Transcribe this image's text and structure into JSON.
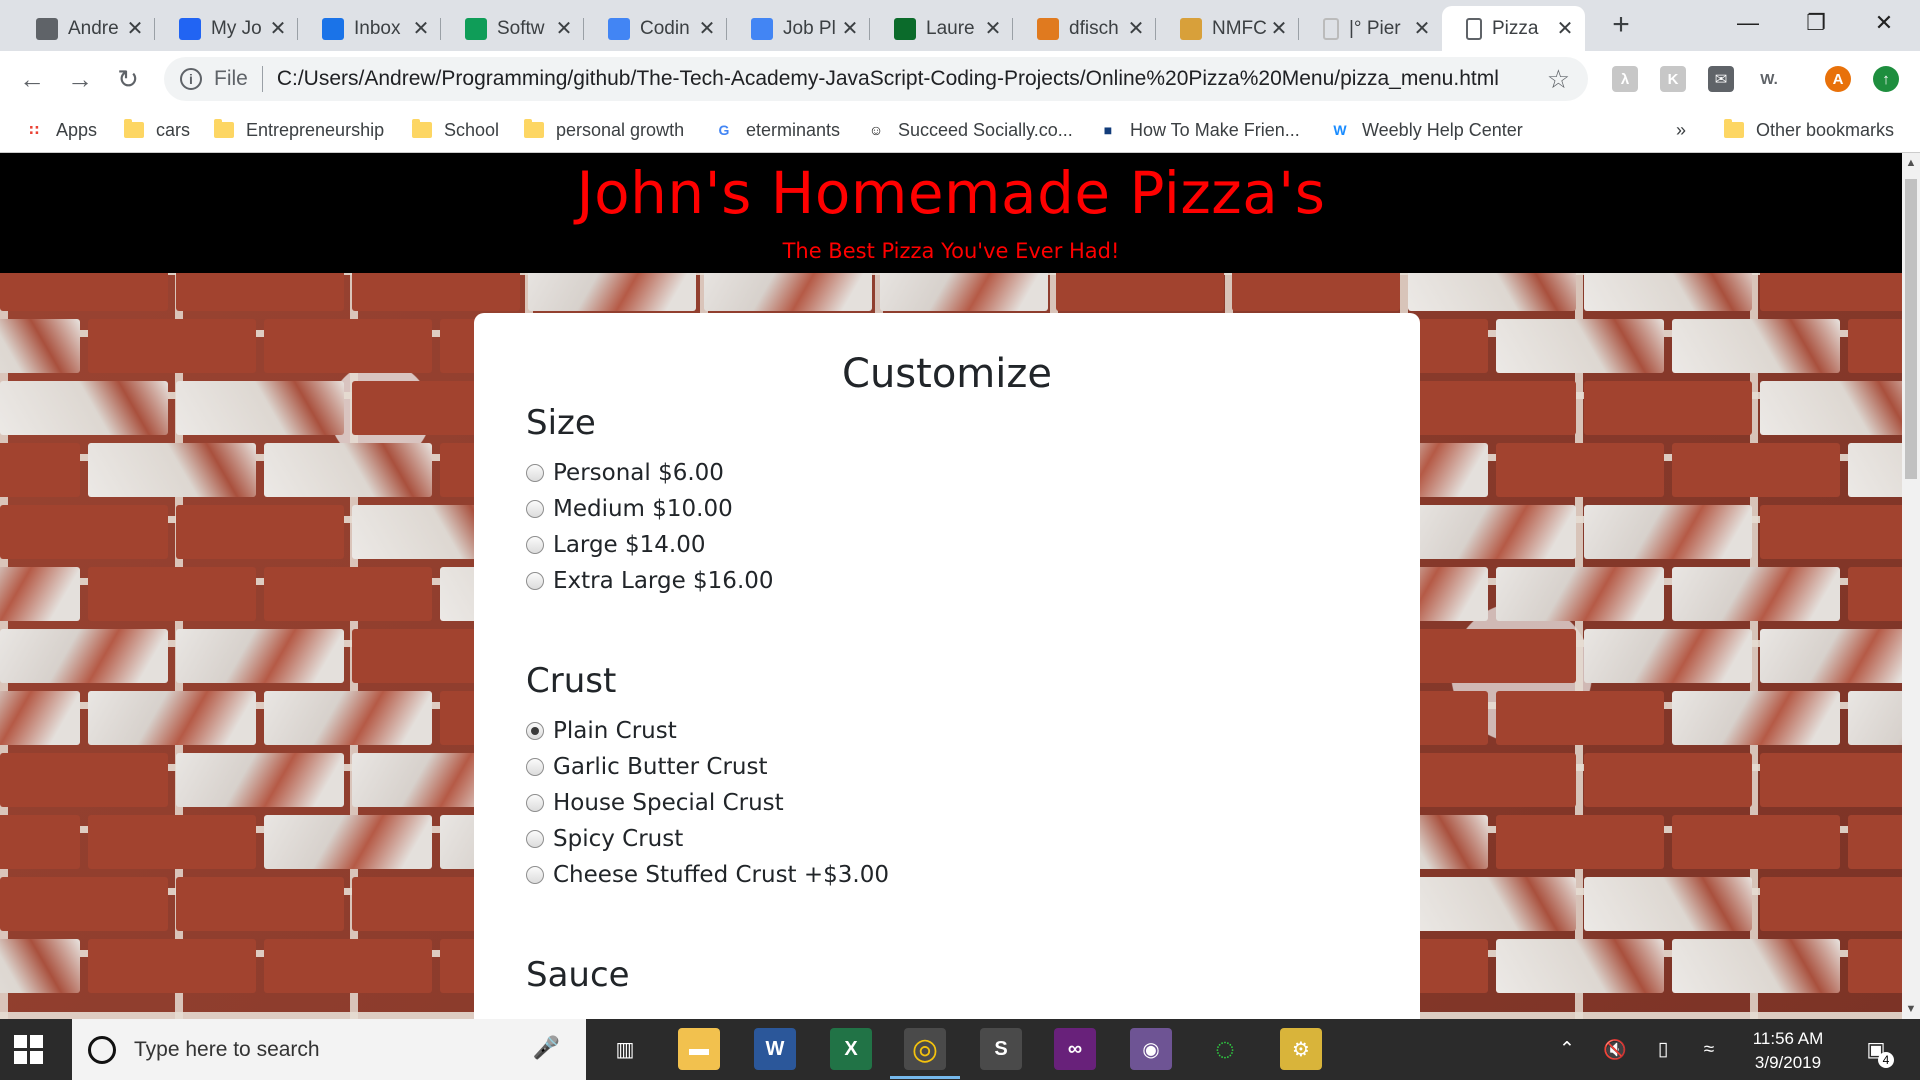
{
  "browser": {
    "tabs": [
      {
        "title": "Andre",
        "icon": "newspaper-icon",
        "color": "#5f6368"
      },
      {
        "title": "My Jo",
        "icon": "indeed-icon",
        "color": "#2164f3"
      },
      {
        "title": "Inbox",
        "icon": "mail-icon",
        "color": "#1a73e8"
      },
      {
        "title": "Softw",
        "icon": "google-drive-icon",
        "color": "#0f9d58"
      },
      {
        "title": "Codin",
        "icon": "google-docs-icon",
        "color": "#4285f4"
      },
      {
        "title": "Job Pl",
        "icon": "google-docs-icon",
        "color": "#4285f4"
      },
      {
        "title": "Laure",
        "icon": "spreadsheet-icon",
        "color": "#0b6b2b"
      },
      {
        "title": "dfisch",
        "icon": "github-cat-icon",
        "color": "#e07a1f"
      },
      {
        "title": "NMFC",
        "icon": "cartoon-icon",
        "color": "#d8a03a"
      },
      {
        "title": "|° Pier",
        "icon": "blank-page-icon",
        "color": "#bbbbbb"
      },
      {
        "title": "Pizza",
        "icon": "page-icon",
        "color": "#5f6368"
      }
    ],
    "active_tab_index": 10,
    "address": {
      "scheme": "File",
      "url": "C:/Users/Andrew/Programming/github/The-Tech-Academy-JavaScript-Coding-Projects/Online%20Pizza%20Menu/pizza_menu.html"
    },
    "profile_initial": "A",
    "bookmarks": [
      {
        "label": "Apps",
        "kind": "apps-grid-icon"
      },
      {
        "label": "cars",
        "kind": "folder-icon"
      },
      {
        "label": "Entrepreneurship",
        "kind": "folder-icon"
      },
      {
        "label": "School",
        "kind": "folder-icon"
      },
      {
        "label": "personal growth",
        "kind": "folder-icon"
      },
      {
        "label": "eterminants",
        "kind": "google-icon"
      },
      {
        "label": "Succeed Socially.co...",
        "kind": "people-icon"
      },
      {
        "label": "How To Make Frien...",
        "kind": "site-icon"
      },
      {
        "label": "Weebly Help Center",
        "kind": "weebly-icon"
      }
    ],
    "overflow": "»",
    "other_bookmarks": "Other bookmarks"
  },
  "page": {
    "title": "John's Homemade Pizza's",
    "tagline": "The Best Pizza You've Ever Had!",
    "panel_heading": "Customize",
    "sections": [
      {
        "heading": "Size",
        "options": [
          {
            "label": "Personal $6.00",
            "checked": false
          },
          {
            "label": "Medium $10.00",
            "checked": false
          },
          {
            "label": "Large $14.00",
            "checked": false
          },
          {
            "label": "Extra Large $16.00",
            "checked": false
          }
        ]
      },
      {
        "heading": "Crust",
        "options": [
          {
            "label": "Plain Crust",
            "checked": true
          },
          {
            "label": "Garlic Butter Crust",
            "checked": false
          },
          {
            "label": "House Special Crust",
            "checked": false
          },
          {
            "label": "Spicy Crust",
            "checked": false
          },
          {
            "label": "Cheese Stuffed Crust +$3.00",
            "checked": false
          }
        ]
      },
      {
        "heading": "Sauce",
        "options": []
      }
    ],
    "colors": {
      "title": "#ff0000",
      "header_bg": "#000000",
      "panel_bg": "#ffffff"
    }
  },
  "taskbar": {
    "search_placeholder": "Type here to search",
    "apps": [
      "task-view-icon",
      "file-explorer-icon",
      "word-icon",
      "excel-icon",
      "chrome-icon",
      "sublime-text-icon",
      "visual-studio-icon",
      "github-desktop-icon",
      "spinner-app-icon",
      "sql-tool-icon"
    ],
    "time": "11:56 AM",
    "date": "3/9/2019",
    "notifications": "4"
  }
}
